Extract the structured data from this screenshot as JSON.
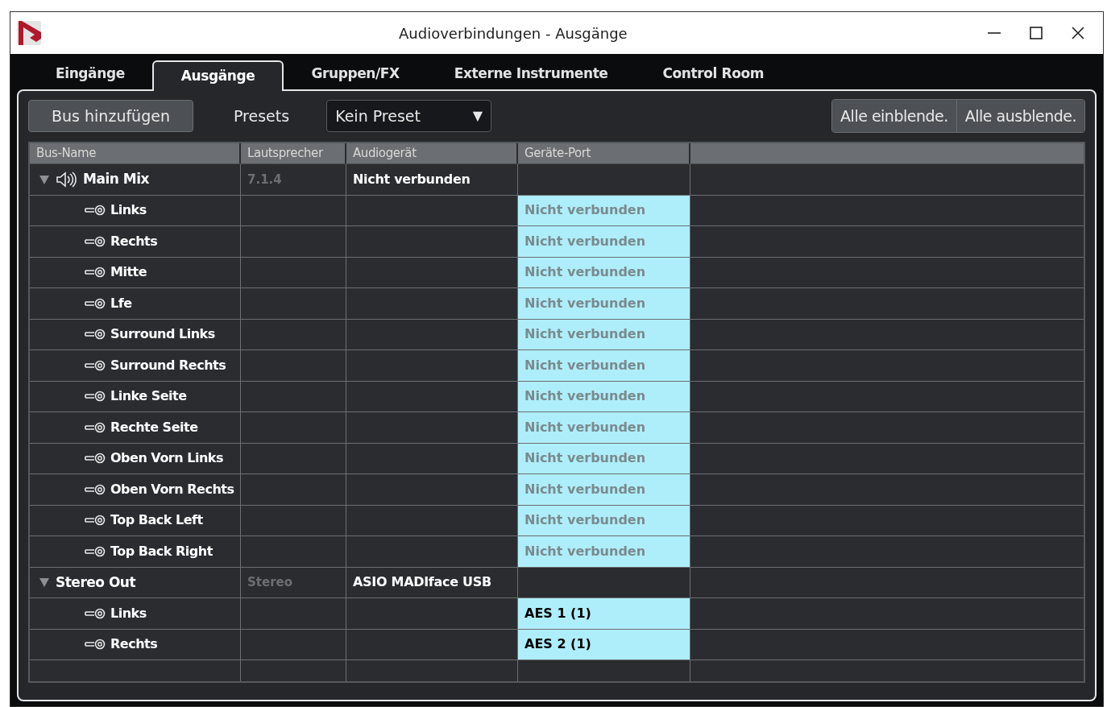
{
  "window": {
    "title": "Audioverbindungen - Ausgänge"
  },
  "tabs": [
    {
      "label": "Eingänge",
      "selected": false
    },
    {
      "label": "Ausgänge",
      "selected": true
    },
    {
      "label": "Gruppen/FX",
      "selected": false
    },
    {
      "label": "Externe Instrumente",
      "selected": false
    },
    {
      "label": "Control Room",
      "selected": false
    }
  ],
  "toolbar": {
    "add_bus": "Bus hinzufügen",
    "presets_label": "Presets",
    "preset": "Kein Preset",
    "dropdown_arrow": "▼",
    "buttons": [
      "Alle einblende.",
      "Alle ausblende."
    ]
  },
  "table": {
    "columns": [
      "Bus-Name",
      "Lautsprecher",
      "Audiogerät",
      "Geräte-Port"
    ],
    "buses": [
      {
        "kind": "speaker",
        "name": "Main Mix",
        "expanded": true,
        "speaker": "7.1.4",
        "device": "Nicht verbunden",
        "children": [
          {
            "name": "Links",
            "port": "Nicht verbunden",
            "connected": false
          },
          {
            "name": "Rechts",
            "port": "Nicht verbunden",
            "connected": false
          },
          {
            "name": "Mitte",
            "port": "Nicht verbunden",
            "connected": false
          },
          {
            "name": "Lfe",
            "port": "Nicht verbunden",
            "connected": false
          },
          {
            "name": "Surround Links",
            "port": "Nicht verbunden",
            "connected": false
          },
          {
            "name": "Surround Rechts",
            "port": "Nicht verbunden",
            "connected": false
          },
          {
            "name": "Linke Seite",
            "port": "Nicht verbunden",
            "connected": false
          },
          {
            "name": "Rechte Seite",
            "port": "Nicht verbunden",
            "connected": false
          },
          {
            "name": "Oben Vorn Links",
            "port": "Nicht verbunden",
            "connected": false
          },
          {
            "name": "Oben Vorn Rechts",
            "port": "Nicht verbunden",
            "connected": false
          },
          {
            "name": "Top Back Left",
            "port": "Nicht verbunden",
            "connected": false
          },
          {
            "name": "Top Back Right",
            "port": "Nicht verbunden",
            "connected": false
          }
        ]
      },
      {
        "kind": "plain",
        "name": "Stereo Out",
        "expanded": true,
        "speaker": "Stereo",
        "device": "ASIO MADIface USB",
        "children": [
          {
            "name": "Links",
            "port": "AES 1 (1)",
            "connected": true
          },
          {
            "name": "Rechts",
            "port": "AES 2 (1)",
            "connected": true
          }
        ]
      }
    ]
  }
}
